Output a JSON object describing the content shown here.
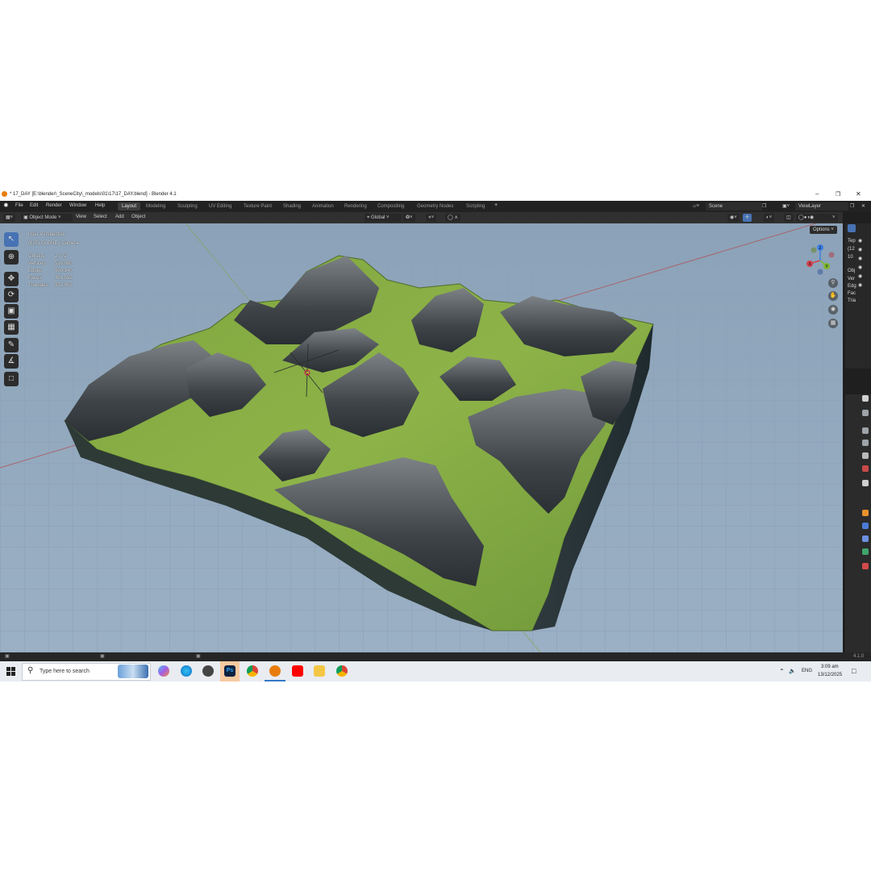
{
  "window": {
    "title": "* 17_DAY [E:\\blender\\_SceneCity\\_models\\01\\17\\17_DAY.blend] - Blender 4.1",
    "minimize_icon": "minimize-icon",
    "maximize_icon": "restore-icon",
    "close_icon": "close-icon"
  },
  "menu": {
    "items": [
      "File",
      "Edit",
      "Render",
      "Window",
      "Help"
    ],
    "workspaces": [
      "Layout",
      "Modeling",
      "Sculpting",
      "UV Editing",
      "Texture Paint",
      "Shading",
      "Animation",
      "Rendering",
      "Compositing",
      "Geometry Nodes",
      "Scripting"
    ],
    "active_workspace": "Layout",
    "add_tab": "+",
    "scene": "Scene",
    "view_layer": "ViewLayer"
  },
  "header": {
    "mode": "Object Mode",
    "menus": [
      "View",
      "Select",
      "Add",
      "Object"
    ],
    "transform_orientation": "Global",
    "options": "Options"
  },
  "viewport": {
    "view_name": "User Perspective",
    "collection": "(125) SCENE | Camera",
    "stats": [
      {
        "label": "Objects",
        "value": "2 / 72"
      },
      {
        "label": "Vertices",
        "value": "510,080"
      },
      {
        "label": "Edges",
        "value": "990,140"
      },
      {
        "label": "Faces",
        "value": "491,592"
      },
      {
        "label": "Triangles",
        "value": "932,005"
      }
    ],
    "gizmo_axes": [
      "X",
      "Y",
      "Z"
    ]
  },
  "right_panel": {
    "outliner_fragments": [
      "Tep",
      "(12",
      "10"
    ],
    "stats_fragments": [
      "Obj",
      "Ver",
      "Edg",
      "Fac",
      "Tria"
    ]
  },
  "statusbar": {
    "version": "4.1.0"
  },
  "taskbar": {
    "search_placeholder": "Type here to search",
    "language": "ENG",
    "time": "3:09 am",
    "date": "13/12/2025"
  }
}
